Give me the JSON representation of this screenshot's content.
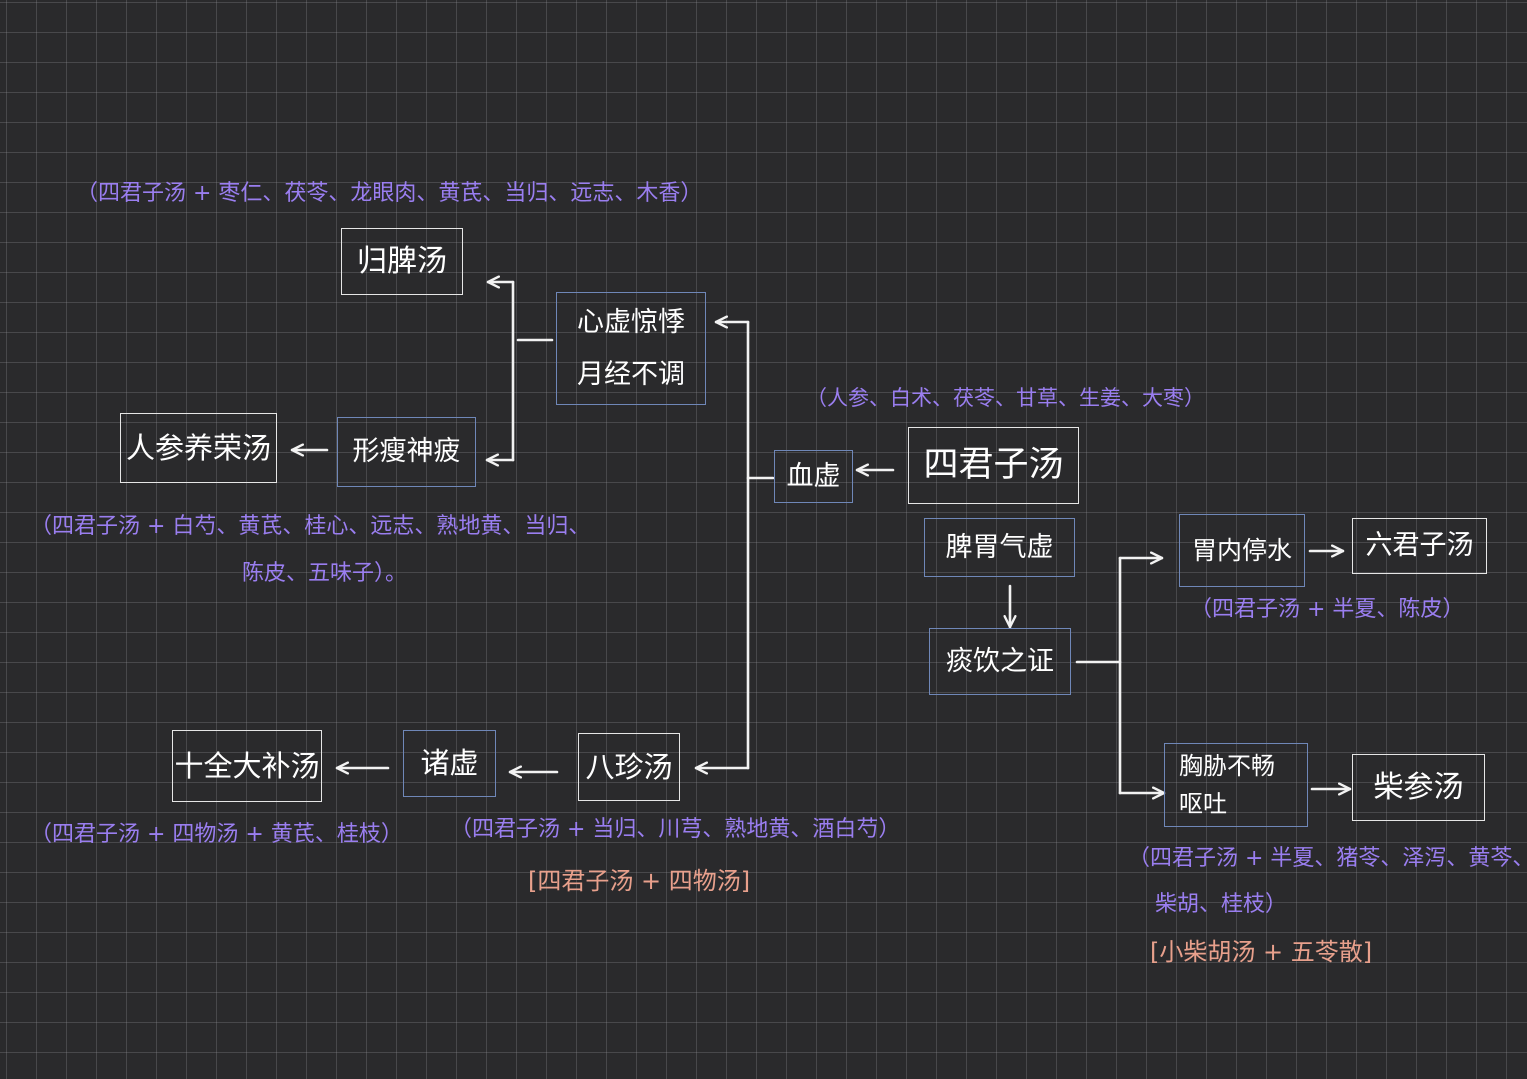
{
  "nodes": {
    "sijunzi": "四君子汤",
    "pixu": "脾胃气虚",
    "tanyin": "痰饮之证",
    "weinei": "胃内停水",
    "liujunzi": "六君子汤",
    "xiongxie": [
      "胸胁不畅",
      "呕吐"
    ],
    "chaishen": "柴参汤",
    "xuexu": "血虚",
    "xinxu": [
      "心虚惊悸",
      "月经不调"
    ],
    "guipi": "归脾汤",
    "xingshou": "形瘦神疲",
    "renshen": "人参养荣汤",
    "bazhen": "八珍汤",
    "xuxu": "诸虚",
    "shiquan": "十全大补汤"
  },
  "notes": {
    "sijunzi": "（人参、白术、茯苓、甘草、生姜、大枣）",
    "guipi": "（四君子汤 + 枣仁、茯苓、龙眼肉、黄芪、当归、远志、木香）",
    "renshen_1": "（四君子汤 + 白芍、黄芪、桂心、远志、熟地黄、当归、",
    "renshen_2": "陈皮、五味子）。",
    "liujunzi": "（四君子汤 + 半夏、陈皮）",
    "chaishen_1": "（四君子汤 + 半夏、猪苓、泽泻、黄芩、",
    "chaishen_2": "柴胡、桂枝）",
    "chaishen_combo": "[小柴胡汤 + 五苓散]",
    "shiquan": "（四君子汤 + 四物汤 + 黄芪、桂枝）",
    "bazhen": "（四君子汤 + 当归、川芎、熟地黄、酒白芍）",
    "bazhen_combo": "[四君子汤 + 四物汤]"
  },
  "colors": {
    "background": "#2a2a2c",
    "grid": "#8e8e92",
    "box_white": "#e6e6e6",
    "box_blue": "#6f87b8",
    "text": "#ffffff",
    "note_purple": "#9a7ef0",
    "note_pink": "#e8a08c",
    "arrow": "#f2f2f2"
  }
}
